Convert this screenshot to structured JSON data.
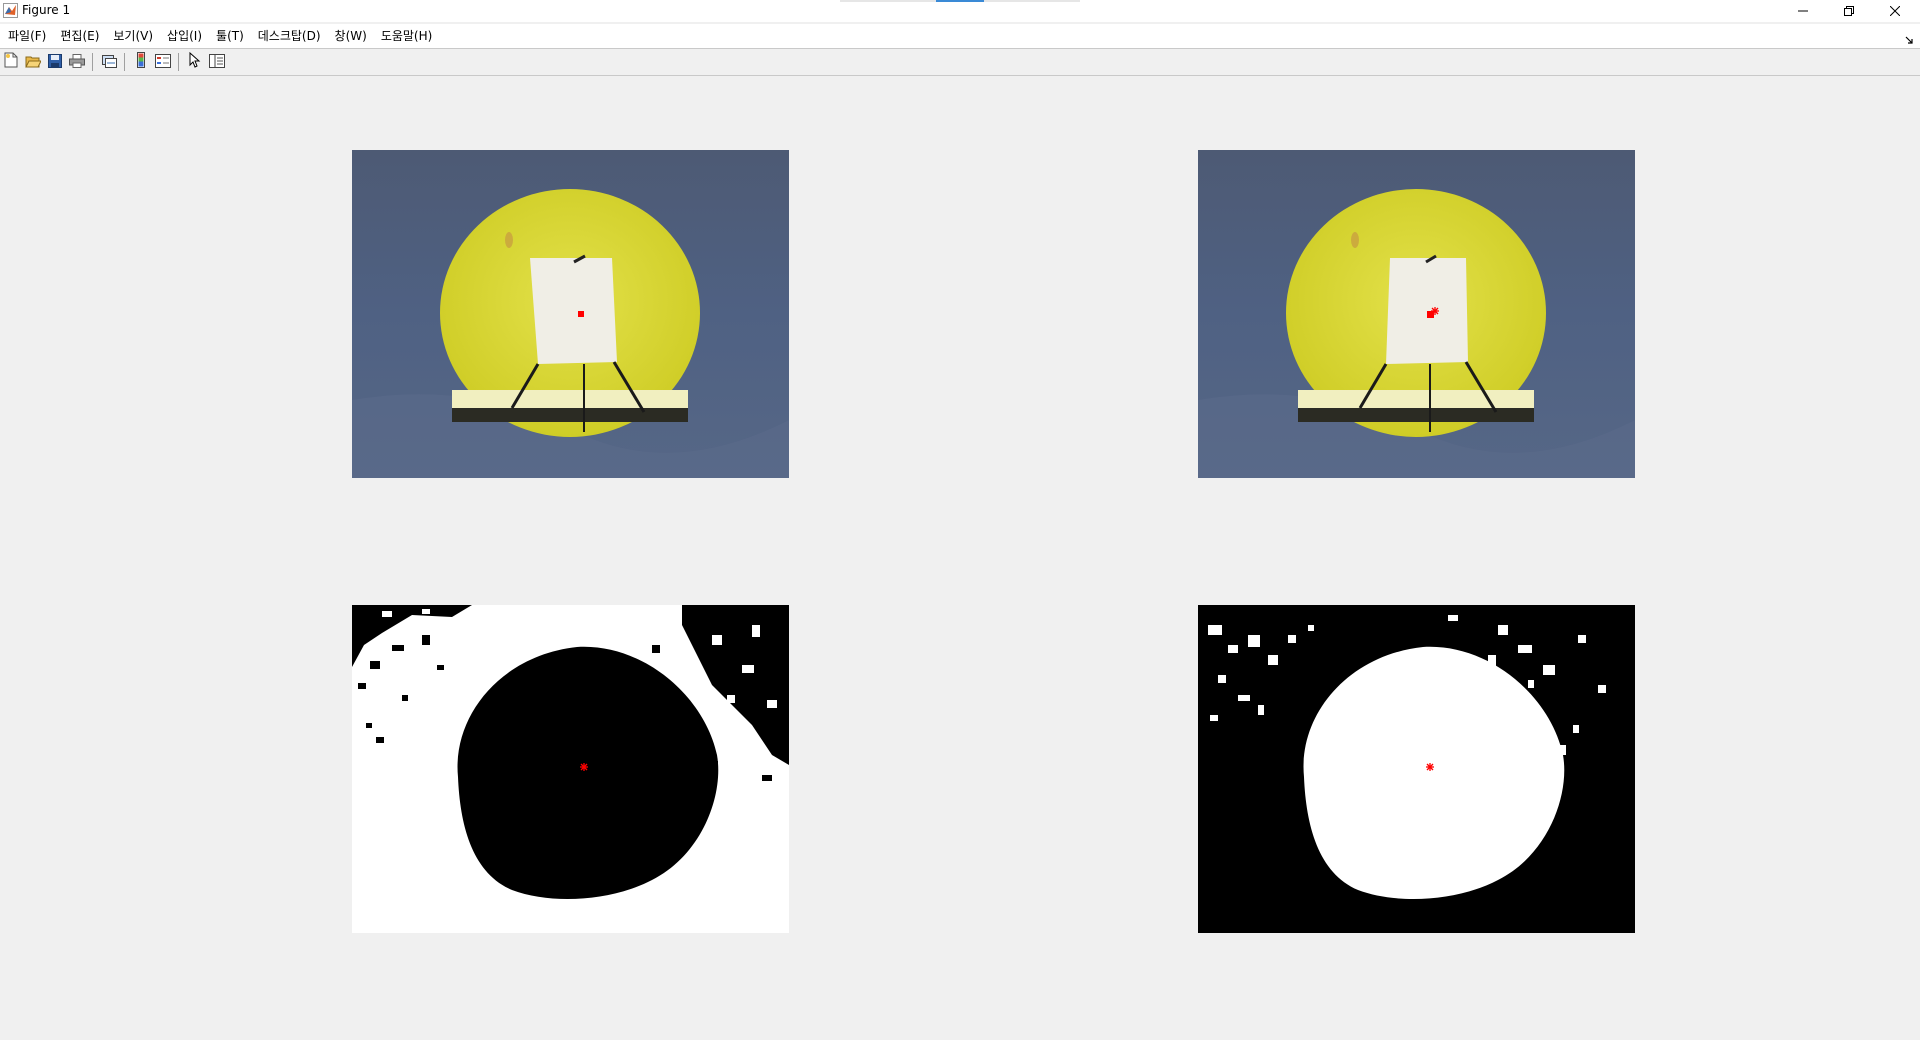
{
  "window": {
    "title": "Figure 1",
    "app_icon": "matlab-icon",
    "controls": [
      "minimize-icon",
      "restore-icon",
      "close-icon"
    ]
  },
  "menu": {
    "items": [
      {
        "label": "파일(F)"
      },
      {
        "label": "편집(E)"
      },
      {
        "label": "보기(V)"
      },
      {
        "label": "삽입(I)"
      },
      {
        "label": "툴(T)"
      },
      {
        "label": "데스크탑(D)"
      },
      {
        "label": "창(W)"
      },
      {
        "label": "도움말(H)"
      }
    ]
  },
  "toolbar": {
    "buttons": [
      "new-figure-icon",
      "open-file-icon",
      "save-icon",
      "print-icon",
      "link-plot-icon",
      "colorbar-icon",
      "legend-icon",
      "edit-plot-cursor-icon",
      "property-inspector-icon"
    ]
  },
  "colors": {
    "background": "#f0f0f0",
    "marker": "#ff0000",
    "backdrop_blue": "#4f5f7d",
    "yellow_disc": "#d4d22a"
  },
  "figure": {
    "subplots": [
      {
        "kind": "photo",
        "marker": "square"
      },
      {
        "kind": "photo",
        "marker": "square-star"
      },
      {
        "kind": "binary-inverted",
        "marker": "star"
      },
      {
        "kind": "binary",
        "marker": "star"
      }
    ]
  }
}
